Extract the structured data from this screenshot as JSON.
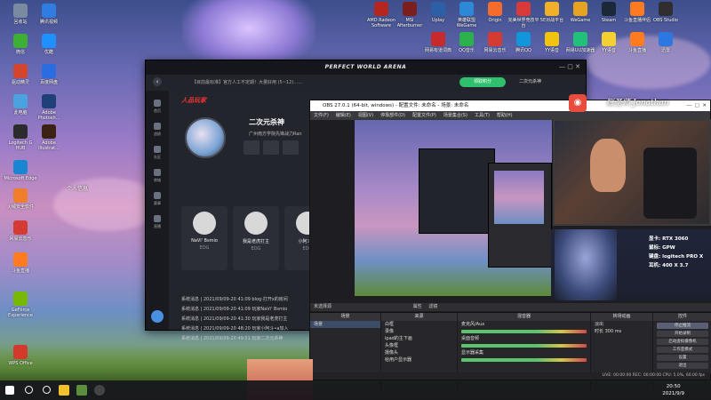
{
  "desktop": {
    "icons_left": [
      {
        "label": "回收站",
        "color": "#7a8aa0"
      },
      {
        "label": "腾讯视频",
        "color": "#2f7de1"
      },
      {
        "label": "微信",
        "color": "#3cb034"
      },
      {
        "label": "优酷",
        "color": "#1e90ff"
      },
      {
        "label": "驱动精灵",
        "color": "#d4452e"
      },
      {
        "label": "百度网盘",
        "color": "#2a6de0"
      },
      {
        "label": "此电脑",
        "color": "#4aa3df"
      },
      {
        "label": "Adobe Photosh...",
        "color": "#1f3f77"
      },
      {
        "label": "Logitech G HUB",
        "color": "#2b2b2b"
      },
      {
        "label": "Adobe Illustrat...",
        "color": "#3b2213"
      },
      {
        "label": "Microsoft Edge",
        "color": "#1a86d2"
      },
      {
        "label": "火绒安全软件",
        "color": "#f07d2b"
      },
      {
        "label": "网易云音乐",
        "color": "#d43c33"
      },
      {
        "label": "斗鱼直播",
        "color": "#ff7b1f"
      },
      {
        "label": "GeForce Experience",
        "color": "#76b900"
      },
      {
        "label": "WPS Office",
        "color": "#d33a2c"
      }
    ],
    "icons_top_right": [
      {
        "label": "AMD Radeon Software",
        "color": "#b5271e"
      },
      {
        "label": "MSI Afterburner",
        "color": "#7a1e1e"
      },
      {
        "label": "Uplay",
        "color": "#2d5fa7"
      },
      {
        "label": "英雄联盟WeGame",
        "color": "#2d88d8"
      },
      {
        "label": "Origin",
        "color": "#f56c2d"
      },
      {
        "label": "完美世界竞技平台",
        "color": "#d83a3a"
      },
      {
        "label": "5E对战平台",
        "color": "#f2b02a"
      },
      {
        "label": "WeGame",
        "color": "#e5a321"
      },
      {
        "label": "Steam",
        "color": "#1b2838"
      },
      {
        "label": "斗鱼直播伴侣",
        "color": "#ff7b1f"
      },
      {
        "label": "OBS Studio",
        "color": "#302e31"
      }
    ],
    "icons_second_row": [
      {
        "label": "网易有道词典",
        "color": "#c72a2a"
      },
      {
        "label": "QQ音乐",
        "color": "#2bb24c"
      },
      {
        "label": "网易云音乐",
        "color": "#d43c33"
      },
      {
        "label": "腾讯QQ",
        "color": "#1296db"
      },
      {
        "label": "YY语音",
        "color": "#f1c40f"
      },
      {
        "label": "网易UU加速器",
        "color": "#22c17a"
      },
      {
        "label": "YY语音",
        "color": "#f3d133"
      },
      {
        "label": "斗鱼直播",
        "color": "#ff7b1f"
      },
      {
        "label": "迅雷",
        "color": "#2c77e0"
      }
    ],
    "stray_label": "个人信息"
  },
  "pwa": {
    "window_title": "PERFECT WORLD ARENA",
    "url_text": "【目前最标准】官方人工不定期！大量好用 (5~12)……",
    "green_button": "领取积分",
    "user_label": "二次元杀神",
    "brand_tag": "人品玩家",
    "sidebar": [
      "首页",
      "战绩",
      "社区",
      "商城",
      "赛事",
      "直播"
    ],
    "profile": {
      "name": "二次元杀神",
      "location": "广州南方学院先锋战力Ran"
    },
    "friends": [
      {
        "name": "NaVi' Bsmio",
        "tag": "EDG"
      },
      {
        "name": "我是老虎打主",
        "tag": "EDG"
      },
      {
        "name": "小阿斗•a",
        "tag": "EDG"
      }
    ],
    "logs": [
      "系统消息 | 2021/09/09-20 41:09 blog·打开x的房间",
      "系统消息 | 2021/09/09-20 41:09 玩家NaVi' Bsmio",
      "系统消息 | 2021/09/09-20 41:30 玩家我是老虎打主",
      "系统消息 | 2021/09/09-20 48:20 玩家小阿斗•a加入",
      "系统消息 | 2021/09/09-20 49:51 玩家二次元杀神"
    ]
  },
  "obs": {
    "title": "OBS 27.0.1 (64-bit, windows) - 配置文件: 未命名 - 场景: 未命名",
    "menu": [
      "文件(F)",
      "编辑(E)",
      "视图(V)",
      "停靠部件(D)",
      "配置文件(P)",
      "场景集合(S)",
      "工具(T)",
      "帮助(H)"
    ],
    "source_label": "未选择源",
    "props_label": "属性",
    "filter_label": "滤镜",
    "docks": {
      "scenes": {
        "title": "场景",
        "items": [
          "场景"
        ]
      },
      "sources": {
        "title": "来源",
        "items": [
          "白框",
          "录像",
          "ipad的主下画",
          "头像框",
          "摄像头",
          "给用户显示器"
        ]
      },
      "mixer": {
        "title": "混音器",
        "channels": [
          "麦克风/Aux",
          "桌面音频",
          "显示器采集"
        ]
      },
      "transitions": {
        "title": "转场动画",
        "type": "淡出",
        "duration_label": "时长",
        "duration": "300 ms"
      },
      "controls": {
        "title": "控件",
        "buttons": [
          "停止推流",
          "开始录制",
          "启动虚拟摄像机",
          "工作室模式",
          "设置",
          "退出"
        ]
      }
    },
    "status": "LIVE: 00:00:00  REC: 00:00:00  CPU: 5.0%, 60.00 fps"
  },
  "webcam": {
    "title": "账圣师 Jonathan",
    "logo": "网易云",
    "specs": [
      "显卡: RTX 3060",
      "鼠标: GPW",
      "键盘: logitech PRO X",
      "耳机: 400 X 3.7"
    ]
  },
  "taskbar": {
    "time": "20:50",
    "date": "2021/9/9"
  }
}
